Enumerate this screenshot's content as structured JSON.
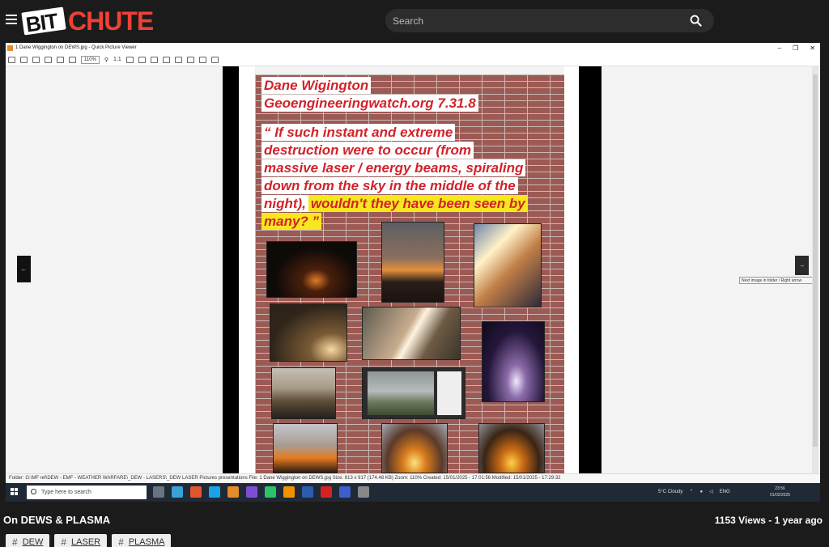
{
  "header": {
    "logo_bit": "BIT",
    "logo_chute": "CHUTE",
    "search_placeholder": "Search"
  },
  "viewer": {
    "window_title": "1 Dane Wiggington on DEWS.jpg - Quick Picture Viewer",
    "window_controls": [
      "–",
      "❐",
      "✕"
    ],
    "zoom_value": "110%",
    "ratio_label": "1:1",
    "slide": {
      "line1": "Dane Wigington",
      "line2": "Geoengineeringwatch.org  7.31.8",
      "line3": "“ If such instant and extreme",
      "line4": "destruction were to occur (from",
      "line5": "massive laser / energy beams, spiraling",
      "line6": "down from the sky in the middle of the",
      "line7a": "night),",
      "line7b": "wouldn't they have been seen by",
      "line8": "many? ”"
    },
    "prev_arrow": "←",
    "next_arrow": "→",
    "tooltip": "Next image in folder / Right arrow",
    "status": "Folder: G:\\MF ref\\DEW - EMF - WEATHER WARFARE\\_DEW - LASERS\\_DEW LASER Pictures presentations     File: 1 Dane Wiggington on DEWS.jpg     Size: 813 x 917 (174.48 KB)     Zoom: 110%     Created: 15/01/2025 - 17:01:56     Modified: 15/01/2025 - 17:29:32"
  },
  "taskbar": {
    "search_placeholder": "Type here to search",
    "weather": "5°C  Cloudy",
    "lang": "ENG",
    "time": "23:56",
    "date": "01/02/2025"
  },
  "video": {
    "title": "On DEWS & PLASMA",
    "views_date": "1153 Views - 1 year ago"
  },
  "tags": [
    "DEW",
    "LASER",
    "PLASMA"
  ],
  "colors": {
    "brand_red": "#ef4136",
    "background": "#1b1b1b",
    "slide_text_red": "#d3222a",
    "highlight_yellow": "#f6e71e"
  }
}
